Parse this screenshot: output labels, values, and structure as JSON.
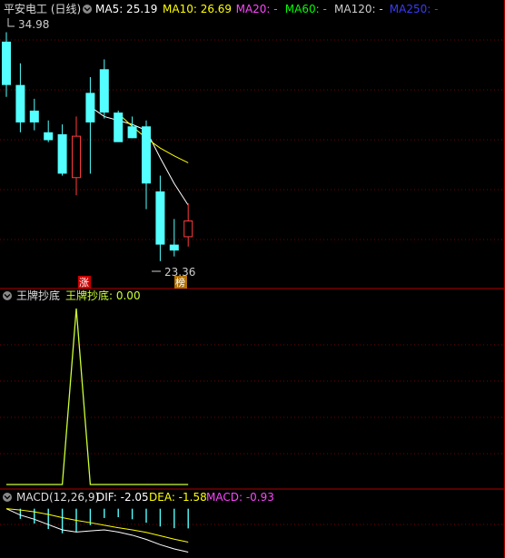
{
  "colors": {
    "up": "#ff3b3b",
    "down": "#54ffff",
    "ma5": "#ffffff",
    "ma10": "#ffff00",
    "ma20": "#ff44ff",
    "ma60": "#00ff00",
    "ma120": "#cccccc",
    "ma250": "#3a3aff",
    "signal": "#ccff33",
    "dif": "#ffffff",
    "dea": "#ffff00",
    "macd": "#ff44ff",
    "grid": "#7a0000",
    "separator": "#b00000",
    "badge_zhang": "#cc0000",
    "badge_bang": "#b07000"
  },
  "main_panel": {
    "title": "平安电工 (日线)",
    "indicators": [
      {
        "label": "MA5: 25.19",
        "color": "#ffffff"
      },
      {
        "label": "MA10: 26.69",
        "color": "#ffff00"
      },
      {
        "label": "MA20: -",
        "color": "#ff44ff"
      },
      {
        "label": "MA60: -",
        "color": "#00ff00"
      },
      {
        "label": "MA120: -",
        "color": "#cccccc"
      },
      {
        "label": "MA250: -",
        "color": "#3a3aff"
      }
    ],
    "high_label": "34.98",
    "low_label": "23.36",
    "badge_zhang": "涨",
    "badge_bang": "榜"
  },
  "signal_panel": {
    "name": "王牌抄底",
    "value_label": "王牌抄底: 0.00"
  },
  "macd_panel": {
    "name": "MACD(12,26,9)",
    "dif_label": "DIF: -2.05",
    "dea_label": "DEA: -1.58",
    "macd_label": "MACD: -0.93"
  },
  "chart_data": [
    {
      "type": "candlestick",
      "title": "平安电工 (日线)",
      "x": [
        1,
        2,
        3,
        4,
        5,
        6,
        7,
        8,
        9,
        10,
        11,
        12,
        13,
        14
      ],
      "open": [
        34.5,
        32.3,
        31.0,
        29.9,
        29.8,
        27.6,
        31.9,
        33.1,
        30.9,
        30.2,
        30.2,
        26.9,
        24.2,
        24.6
      ],
      "high": [
        34.98,
        33.4,
        31.6,
        30.5,
        30.3,
        30.7,
        32.7,
        33.6,
        31.0,
        30.7,
        30.5,
        27.7,
        25.5,
        26.3
      ],
      "low": [
        31.7,
        29.9,
        30.0,
        29.4,
        27.7,
        26.7,
        27.8,
        30.6,
        29.5,
        29.6,
        26.0,
        23.36,
        23.6,
        24.1
      ],
      "close": [
        32.3,
        30.4,
        30.4,
        29.5,
        27.8,
        29.7,
        30.4,
        30.9,
        29.4,
        29.6,
        27.3,
        24.2,
        23.9,
        25.4
      ],
      "ma5": [
        null,
        null,
        null,
        null,
        null,
        null,
        31.2,
        30.7,
        30.5,
        30.3,
        30.0,
        28.6,
        27.3,
        26.2
      ],
      "ma10": [
        null,
        null,
        null,
        null,
        null,
        null,
        null,
        null,
        30.85,
        30.2,
        29.6,
        29.1,
        28.7,
        28.35
      ],
      "high_label": 34.98,
      "low_label": 23.36
    },
    {
      "type": "line",
      "title": "王牌抄底",
      "x": [
        1,
        2,
        3,
        4,
        5,
        6,
        7,
        8,
        9,
        10,
        11,
        12,
        13,
        14
      ],
      "series": [
        {
          "name": "王牌抄底",
          "values": [
            0,
            0,
            0,
            0,
            0,
            1,
            0,
            0,
            0,
            0,
            0,
            0,
            0,
            0
          ]
        }
      ],
      "ylim": [
        0,
        1
      ]
    },
    {
      "type": "line",
      "title": "MACD(12,26,9)",
      "x": [
        1,
        2,
        3,
        4,
        5,
        6,
        7,
        8,
        9,
        10,
        11,
        12,
        13,
        14
      ],
      "series": [
        {
          "name": "DIF",
          "values": [
            0.0,
            -0.3,
            -0.5,
            -0.75,
            -1.0,
            -1.1,
            -1.05,
            -1.0,
            -1.1,
            -1.25,
            -1.45,
            -1.7,
            -1.9,
            -2.05
          ]
        },
        {
          "name": "DEA",
          "values": [
            0.0,
            -0.06,
            -0.15,
            -0.27,
            -0.42,
            -0.55,
            -0.66,
            -0.78,
            -0.9,
            -1.0,
            -1.12,
            -1.28,
            -1.44,
            -1.58
          ]
        },
        {
          "name": "MACD",
          "values": [
            0.0,
            -0.48,
            -0.7,
            -0.96,
            -1.16,
            -1.1,
            -0.78,
            -0.44,
            -0.4,
            -0.5,
            -0.66,
            -0.84,
            -0.92,
            -0.93
          ]
        }
      ],
      "ylim": [
        -2.2,
        0.2
      ]
    }
  ]
}
